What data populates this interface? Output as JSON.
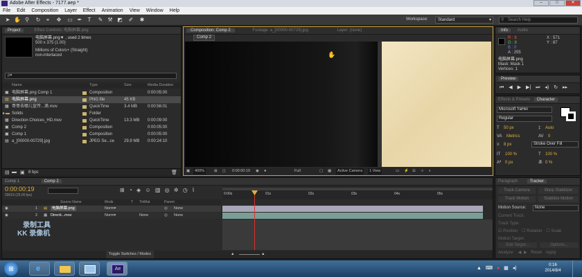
{
  "window": {
    "title": "Adobe After Effects - 7177.aep *"
  },
  "menu": [
    "File",
    "Edit",
    "Composition",
    "Layer",
    "Effect",
    "Animation",
    "View",
    "Window",
    "Help"
  ],
  "workspace": {
    "label": "Workspace:",
    "value": "Standard",
    "search_placeholder": "Search Help"
  },
  "project": {
    "tab": "Project",
    "tab2": "Effect Controls: 电脑屏幕.png",
    "thumb_name": "电脑屏幕.png▼ , used 2 times",
    "thumb_info1": "500 x 375 (1.00)",
    "thumb_info2": "Millions of Colors+ (Straight)",
    "thumb_info3": "non-interlaced",
    "search_placeholder": "ρ▾",
    "columns": [
      "Name",
      "Type",
      "Size",
      "Media Duration"
    ],
    "items": [
      {
        "name": "电脑屏幕.png Comp 1",
        "type": "Composition",
        "size": "",
        "dur": "0:00:05:00",
        "color": "#c9b66d",
        "selected": false
      },
      {
        "name": "电脑屏幕.png",
        "type": "PNG file",
        "size": "45 KB",
        "dur": "",
        "color": "#c9b66d",
        "selected": true
      },
      {
        "name": "哥哥去哪儿宣传...滴.mov",
        "type": "QuickTime",
        "size": "3.4 MB",
        "dur": "0:00:56:01",
        "color": "#c9b66d",
        "selected": false
      },
      {
        "name": "Solids",
        "type": "Folder",
        "size": "",
        "dur": "",
        "color": "#c9b66d",
        "selected": false
      },
      {
        "name": "Direction Choices_HD.mov",
        "type": "QuickTime",
        "size": "13.3 MB",
        "dur": "0:00:09:00",
        "color": "#c9b66d",
        "selected": false
      },
      {
        "name": "Comp 2",
        "type": "Composition",
        "size": "",
        "dur": "0:00:05:00",
        "color": "#c9b66d",
        "selected": false
      },
      {
        "name": "Comp 1",
        "type": "Composition",
        "size": "",
        "dur": "0:00:05:00",
        "color": "#c9b66d",
        "selected": false
      },
      {
        "name": "a_[00000-00729].jpg",
        "type": "JPEG Se...ce",
        "size": "29.9 MB",
        "dur": "0:00:24:10",
        "color": "#c9b66d",
        "selected": false
      }
    ],
    "bpc": "8 bpc"
  },
  "composition": {
    "tab_comp": "Composition: Comp 2",
    "tab_footage": "Footage: a_[00000-00729].jpg",
    "tab_layer": "Layer: (none)",
    "comp_button": "Comp 2",
    "zoom": "400%",
    "timecode": "0:00:00:19",
    "resolution": "Full",
    "camera": "Active Camera",
    "views": "1 View"
  },
  "info": {
    "tab": "Info",
    "tab2": "Audio",
    "r": "R : 8",
    "g": "G : 8",
    "b": "B : 0",
    "a": "A : 255",
    "x": "X : 571",
    "y": "Y : 87",
    "file": "电脑屏幕.png",
    "mask": "Mask: Mask 1",
    "vertices": "Vertices: 1"
  },
  "preview": {
    "tab": "Preview"
  },
  "character": {
    "tab_effects": "Effects & Presets",
    "tab_char": "Character",
    "font": "Microsoft YaHei",
    "style": "Regular",
    "size": "50 px",
    "leading": "Auto",
    "kerning": "Metrics",
    "tracking": "0",
    "stroke_width": "8 px",
    "stroke_mode": "Stroke Over Fill",
    "vscale": "100 %",
    "hscale": "100 %",
    "baseline": "0 px",
    "tsume": "0 %"
  },
  "tracker": {
    "tab_paragraph": "Paragraph",
    "tab_tracker": "Tracker",
    "track_camera": "Track Camera",
    "warp_stabilizer": "Warp Stabilizer",
    "track_motion": "Track Motion",
    "stabilize_motion": "Stabilize Motion",
    "motion_source_label": "Motion Source:",
    "motion_source": "None",
    "current_track": "Current Track:",
    "track_type": "Track Type:",
    "position": "Position",
    "rotation": "Rotation",
    "scale": "Scale",
    "motion_target": "Motion Target:",
    "edit_target": "Edit Target...",
    "options": "Options...",
    "analyze": "Analyze:",
    "reset": "Reset",
    "apply": "Apply"
  },
  "timeline": {
    "tab1": "Comp 1",
    "tab2": "Comp 2",
    "timecode": "0:00:00:19",
    "fps": "00019 (25.00 fps)",
    "columns": [
      "Source Name",
      "Mode",
      "T",
      "TrkMat",
      "Parent"
    ],
    "layers": [
      {
        "num": "1",
        "name": "电脑屏幕.png",
        "mode": "Norm▾",
        "trk": "",
        "parent": "None"
      },
      {
        "num": "2",
        "name": "Directi...mov",
        "mode": "Norm▾",
        "trk": "None",
        "parent": "None"
      }
    ],
    "ruler": [
      "0:00s",
      "01s",
      "02s",
      "03s",
      "04s",
      "05s"
    ],
    "toggle": "Toggle Switches / Modes"
  },
  "watermark": {
    "line1": "录制工具",
    "line2": "KK 录像机"
  },
  "taskbar": {
    "time": "0:16",
    "date": "2014/8/4"
  }
}
